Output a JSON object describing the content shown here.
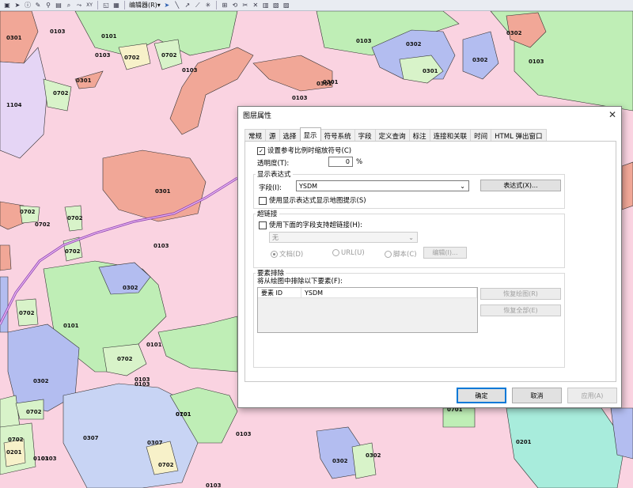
{
  "toolbar": {
    "editor_menu": "编辑器(R)▾",
    "xy_label": "XY"
  },
  "map": {
    "labels": [
      "0301",
      "0103",
      "0101",
      "0702",
      "0702",
      "0302",
      "0702",
      "0301",
      "0103",
      "0302",
      "0103",
      "0301",
      "1104",
      "0702",
      "0301",
      "0103",
      "0702",
      "0702",
      "0301",
      "0103",
      "0301",
      "0302",
      "0702",
      "0702",
      "0101",
      "0101",
      "0702",
      "0302",
      "0103",
      "0702",
      "0302",
      "0103",
      "0101",
      "0307",
      "0307",
      "0701",
      "0103",
      "0302",
      "0702",
      "0201",
      "0201",
      "0103",
      "0103",
      "0701",
      "0103",
      "0702",
      "0103",
      "0302",
      "0103"
    ]
  },
  "dialog": {
    "title": "图层属性",
    "close_glyph": "✕",
    "tabs": [
      "常规",
      "源",
      "选择",
      "显示",
      "符号系统",
      "字段",
      "定义查询",
      "标注",
      "连接和关联",
      "时间",
      "HTML 弹出窗口"
    ],
    "active_tab": "显示",
    "scale_symbols_label": "设置参考比例时缩放符号(C)",
    "scale_symbols_check": "✓",
    "transparency_label": "透明度(T):",
    "transparency_value": "0",
    "transparency_unit": "%",
    "display_expression": {
      "group_title": "显示表达式",
      "field_label": "字段(I):",
      "field_value": "YSDM",
      "dropdown_glyph": "⌄",
      "expression_button": "表达式(X)...",
      "map_tips_label": "使用显示表达式显示地图提示(S)"
    },
    "hyperlinks": {
      "group_title": "超链接",
      "support_label": "使用下面的字段支持超链接(H):",
      "field_value": "无",
      "radio_document": "文档(D)",
      "radio_url": "URL(U)",
      "radio_script": "脚本(C)",
      "edit_button": "编辑(I)..."
    },
    "exclusion": {
      "group_title": "要素排除",
      "description": "将从绘图中排除以下要素(F):",
      "col_id": "要素 ID",
      "col_field": "YSDM",
      "restore_drawing_button": "恢复绘图(R)",
      "restore_all_button": "恢复全部(E)"
    },
    "footer": {
      "ok": "确定",
      "cancel": "取消",
      "apply": "应用(A)"
    }
  }
}
